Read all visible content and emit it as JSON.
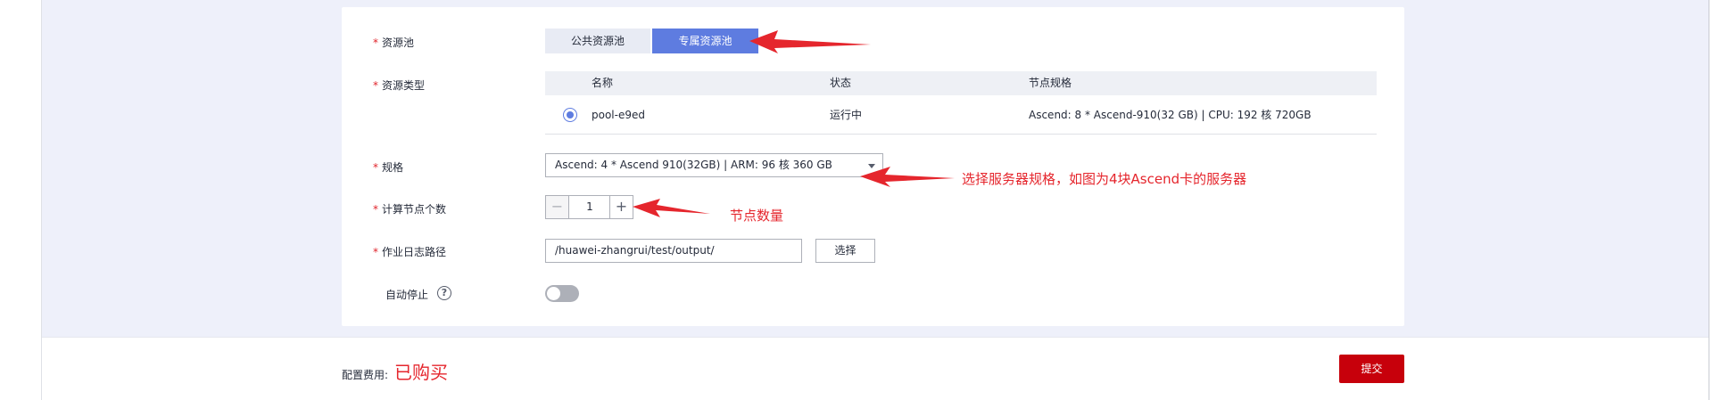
{
  "form": {
    "resource_pool": {
      "label": "资源池",
      "options": [
        "公共资源池",
        "专属资源池"
      ],
      "selected": "专属资源池"
    },
    "resource_type": {
      "label": "资源类型",
      "columns": [
        "名称",
        "状态",
        "节点规格"
      ],
      "rows": [
        {
          "name": "pool-e9ed",
          "status": "运行中",
          "spec": "Ascend: 8 * Ascend-910(32 GB) | CPU: 192 核 720GB",
          "selected": true
        }
      ]
    },
    "spec": {
      "label": "规格",
      "value": "Ascend: 4 * Ascend 910(32GB) | ARM: 96 核 360 GB"
    },
    "node_count": {
      "label": "计算节点个数",
      "value": "1",
      "minus": "−",
      "plus": "+"
    },
    "log_path": {
      "label": "作业日志路径",
      "value": "/huawei-zhangrui/test/output/",
      "button": "选择"
    },
    "auto_stop": {
      "label": "自动停止",
      "help": "?",
      "enabled": false
    }
  },
  "annotations": {
    "spec_note": "选择服务器规格，如图为4块Ascend卡的服务器",
    "count_note": "节点数量",
    "arrow_color": "#e5262d"
  },
  "footer": {
    "cost_label": "配置费用:",
    "cost_value": "已购买",
    "submit": "提交"
  },
  "colors": {
    "primary": "#5e7ce0",
    "submit": "#c7000b",
    "required": "#e0242b"
  }
}
